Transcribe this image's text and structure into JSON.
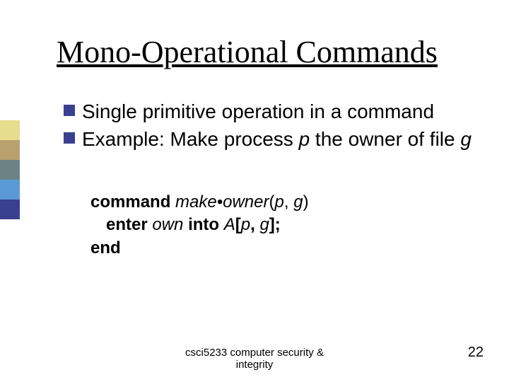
{
  "title": "Mono-Operational Commands",
  "bullets": [
    "Single primitive operation in a command",
    "Example: Make process p the owner of file g"
  ],
  "bullets_rich": {
    "1": {
      "prefix": "Example: Make process ",
      "p": "p",
      "mid": " the owner of file ",
      "g": "g"
    }
  },
  "code": {
    "line1": {
      "kw": "command",
      "fn": "make•owner",
      "lp": "(",
      "p": "p",
      "comma": ", ",
      "g": "g",
      "rp": ")"
    },
    "line2": {
      "kw": "enter",
      "own": "own",
      "into": "into",
      "A": "A",
      "lb": "[",
      "p": "p",
      "comma": ",",
      "g": "g",
      "rb": "];"
    },
    "line3": {
      "kw": "end"
    }
  },
  "footer": {
    "line1": "csci5233 computer security &",
    "line2": "integrity"
  },
  "page": "22"
}
